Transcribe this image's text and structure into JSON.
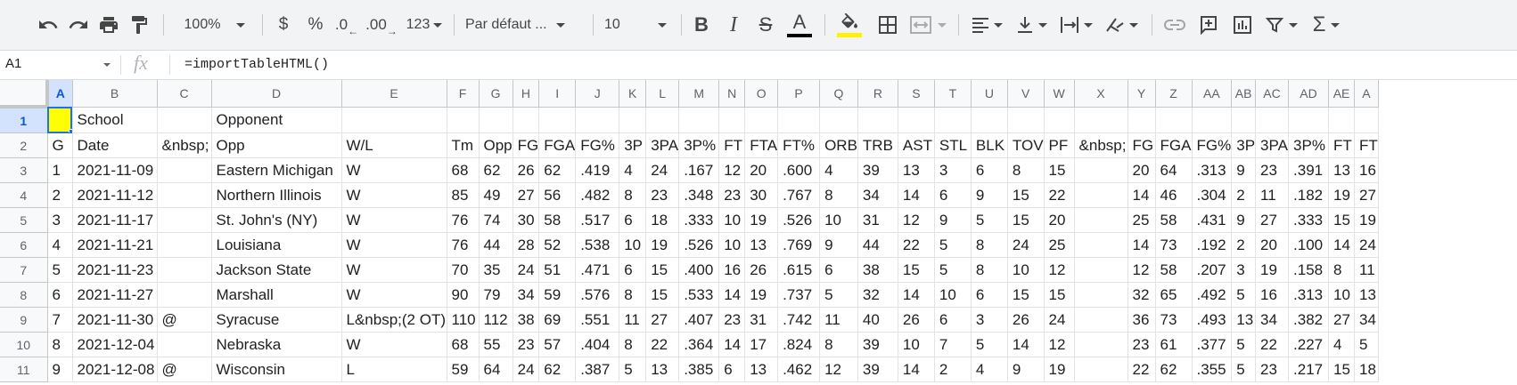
{
  "toolbar": {
    "zoom": "100%",
    "currency": "$",
    "percent": "%",
    "dec_decrease": ".0",
    "dec_increase": ".00",
    "more_formats": "123",
    "font_family": "Par défaut ...",
    "font_size": "10",
    "bold": "B",
    "italic": "I",
    "strike": "S",
    "text_color": "A",
    "text_color_swatch": "#000000",
    "fill_color_swatch": "#fff200",
    "sum": "Σ"
  },
  "formula_bar": {
    "cell_ref": "A1",
    "fx": "fx",
    "formula": "=importTableHTML()"
  },
  "columns": [
    "A",
    "B",
    "C",
    "D",
    "E",
    "F",
    "G",
    "H",
    "I",
    "J",
    "K",
    "L",
    "M",
    "N",
    "O",
    "P",
    "Q",
    "R",
    "S",
    "T",
    "U",
    "V",
    "W",
    "X",
    "Y",
    "Z",
    "AA",
    "AB",
    "AC",
    "AD",
    "AE",
    "A"
  ],
  "rows": [
    {
      "num": "1",
      "cells": [
        "",
        "School",
        "",
        "Opponent",
        "",
        "",
        "",
        "",
        "",
        "",
        "",
        "",
        "",
        "",
        "",
        "",
        "",
        "",
        "",
        "",
        "",
        "",
        "",
        "",
        "",
        "",
        "",
        "",
        "",
        "",
        "",
        ""
      ]
    },
    {
      "num": "2",
      "cells": [
        "G",
        "Date",
        "&nbsp;",
        "Opp",
        "W/L",
        "Tm",
        "Opp",
        "FG",
        "FGA",
        "FG%",
        "3P",
        "3PA",
        "3P%",
        "FT",
        "FTA",
        "FT%",
        "ORB",
        "TRB",
        "AST",
        "STL",
        "BLK",
        "TOV",
        "PF",
        "&nbsp;",
        "FG",
        "FGA",
        "FG%",
        "3P",
        "3PA",
        "3P%",
        "FT",
        "FT"
      ]
    },
    {
      "num": "3",
      "cells": [
        "1",
        "2021-11-09",
        "",
        "Eastern Michigan",
        "W",
        "68",
        "62",
        "26",
        "62",
        ".419",
        "4",
        "24",
        ".167",
        "12",
        "20",
        ".600",
        "4",
        "39",
        "13",
        "3",
        "6",
        "8",
        "15",
        "",
        "20",
        "64",
        ".313",
        "9",
        "23",
        ".391",
        "13",
        "16"
      ]
    },
    {
      "num": "4",
      "cells": [
        "2",
        "2021-11-12",
        "",
        "Northern Illinois",
        "W",
        "85",
        "49",
        "27",
        "56",
        ".482",
        "8",
        "23",
        ".348",
        "23",
        "30",
        ".767",
        "8",
        "34",
        "14",
        "6",
        "9",
        "15",
        "22",
        "",
        "14",
        "46",
        ".304",
        "2",
        "11",
        ".182",
        "19",
        "27"
      ]
    },
    {
      "num": "5",
      "cells": [
        "3",
        "2021-11-17",
        "",
        "St. John's (NY)",
        "W",
        "76",
        "74",
        "30",
        "58",
        ".517",
        "6",
        "18",
        ".333",
        "10",
        "19",
        ".526",
        "10",
        "31",
        "12",
        "9",
        "5",
        "15",
        "20",
        "",
        "25",
        "58",
        ".431",
        "9",
        "27",
        ".333",
        "15",
        "19"
      ]
    },
    {
      "num": "6",
      "cells": [
        "4",
        "2021-11-21",
        "",
        "Louisiana",
        "W",
        "76",
        "44",
        "28",
        "52",
        ".538",
        "10",
        "19",
        ".526",
        "10",
        "13",
        ".769",
        "9",
        "44",
        "22",
        "5",
        "8",
        "24",
        "25",
        "",
        "14",
        "73",
        ".192",
        "2",
        "20",
        ".100",
        "14",
        "24"
      ]
    },
    {
      "num": "7",
      "cells": [
        "5",
        "2021-11-23",
        "",
        "Jackson State",
        "W",
        "70",
        "35",
        "24",
        "51",
        ".471",
        "6",
        "15",
        ".400",
        "16",
        "26",
        ".615",
        "6",
        "38",
        "15",
        "5",
        "8",
        "10",
        "12",
        "",
        "12",
        "58",
        ".207",
        "3",
        "19",
        ".158",
        "8",
        "11"
      ]
    },
    {
      "num": "8",
      "cells": [
        "6",
        "2021-11-27",
        "",
        "Marshall",
        "W",
        "90",
        "79",
        "34",
        "59",
        ".576",
        "8",
        "15",
        ".533",
        "14",
        "19",
        ".737",
        "5",
        "32",
        "14",
        "10",
        "6",
        "15",
        "15",
        "",
        "32",
        "65",
        ".492",
        "5",
        "16",
        ".313",
        "10",
        "13"
      ]
    },
    {
      "num": "9",
      "cells": [
        "7",
        "2021-11-30",
        "@",
        "Syracuse",
        "L&nbsp;(2 OT)",
        "110",
        "112",
        "38",
        "69",
        ".551",
        "11",
        "27",
        ".407",
        "23",
        "31",
        ".742",
        "11",
        "40",
        "26",
        "6",
        "3",
        "26",
        "24",
        "",
        "36",
        "73",
        ".493",
        "13",
        "34",
        ".382",
        "27",
        "34"
      ]
    },
    {
      "num": "10",
      "cells": [
        "8",
        "2021-12-04",
        "",
        "Nebraska",
        "W",
        "68",
        "55",
        "23",
        "57",
        ".404",
        "8",
        "22",
        ".364",
        "14",
        "17",
        ".824",
        "8",
        "39",
        "10",
        "7",
        "5",
        "14",
        "12",
        "",
        "23",
        "61",
        ".377",
        "5",
        "22",
        ".227",
        "4",
        "5"
      ]
    },
    {
      "num": "11",
      "cells": [
        "9",
        "2021-12-08",
        "@",
        "Wisconsin",
        "L",
        "59",
        "64",
        "24",
        "62",
        ".387",
        "5",
        "13",
        ".385",
        "6",
        "13",
        ".462",
        "12",
        "39",
        "14",
        "2",
        "4",
        "9",
        "19",
        "",
        "22",
        "62",
        ".355",
        "5",
        "23",
        ".217",
        "15",
        "18"
      ]
    }
  ]
}
